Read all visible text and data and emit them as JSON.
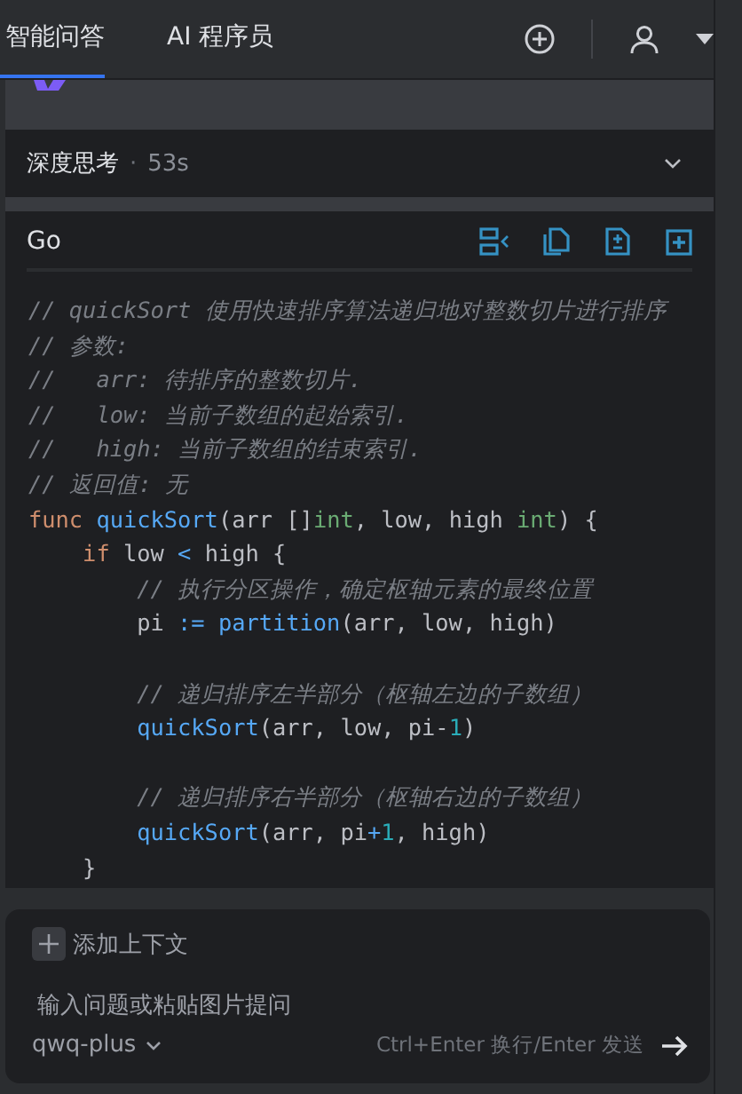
{
  "tabs": [
    {
      "label": "智能问答",
      "selected": true
    },
    {
      "label": "AI 程序员",
      "selected": false
    }
  ],
  "thinking": {
    "label": "深度思考",
    "separator": "·",
    "duration": "53s",
    "expanded": false
  },
  "code_block": {
    "language": "Go",
    "lines": [
      {
        "kind": "code",
        "tokens": [
          {
            "kind": "comment",
            "text": "// quickSort 使用快速排序算法递归地对整数切片进行排序"
          }
        ]
      },
      {
        "kind": "code",
        "tokens": [
          {
            "kind": "comment",
            "text": "// 参数:"
          }
        ]
      },
      {
        "kind": "code",
        "tokens": [
          {
            "kind": "comment",
            "text": "//   arr: 待排序的整数切片."
          }
        ]
      },
      {
        "kind": "code",
        "tokens": [
          {
            "kind": "comment",
            "text": "//   low: 当前子数组的起始索引."
          }
        ]
      },
      {
        "kind": "code",
        "tokens": [
          {
            "kind": "comment",
            "text": "//   high: 当前子数组的结束索引."
          }
        ]
      },
      {
        "kind": "code",
        "tokens": [
          {
            "kind": "comment",
            "text": "// 返回值: 无"
          }
        ]
      },
      {
        "kind": "code",
        "tokens": [
          {
            "kind": "keyword",
            "text": "func "
          },
          {
            "kind": "function",
            "text": "quickSort"
          },
          {
            "kind": "plain",
            "text": "(arr []"
          },
          {
            "kind": "type",
            "text": "int"
          },
          {
            "kind": "plain",
            "text": ", low, high "
          },
          {
            "kind": "type",
            "text": "int"
          },
          {
            "kind": "plain",
            "text": ") {"
          }
        ]
      },
      {
        "kind": "code",
        "tokens": [
          {
            "kind": "keyword",
            "text": "    if "
          },
          {
            "kind": "plain",
            "text": "low "
          },
          {
            "kind": "operator",
            "text": "<"
          },
          {
            "kind": "plain",
            "text": " high {"
          }
        ]
      },
      {
        "kind": "code",
        "tokens": [
          {
            "kind": "comment",
            "text": "        // 执行分区操作，确定枢轴元素的最终位置"
          }
        ]
      },
      {
        "kind": "code",
        "tokens": [
          {
            "kind": "plain",
            "text": "        pi "
          },
          {
            "kind": "operator",
            "text": ":="
          },
          {
            "kind": "function",
            "text": " partition"
          },
          {
            "kind": "plain",
            "text": "(arr, low, high)"
          }
        ]
      },
      {
        "kind": "blank"
      },
      {
        "kind": "code",
        "tokens": [
          {
            "kind": "comment",
            "text": "        // 递归排序左半部分（枢轴左边的子数组）"
          }
        ]
      },
      {
        "kind": "code",
        "tokens": [
          {
            "kind": "function",
            "text": "        quickSort"
          },
          {
            "kind": "plain",
            "text": "(arr, low, pi-"
          },
          {
            "kind": "number",
            "text": "1"
          },
          {
            "kind": "plain",
            "text": ")"
          }
        ]
      },
      {
        "kind": "blank"
      },
      {
        "kind": "code",
        "tokens": [
          {
            "kind": "comment",
            "text": "        // 递归排序右半部分（枢轴右边的子数组）"
          }
        ]
      },
      {
        "kind": "code",
        "tokens": [
          {
            "kind": "function",
            "text": "        quickSort"
          },
          {
            "kind": "plain",
            "text": "(arr, pi"
          },
          {
            "kind": "operator",
            "text": "+"
          },
          {
            "kind": "number",
            "text": "1"
          },
          {
            "kind": "plain",
            "text": ", high)"
          }
        ]
      },
      {
        "kind": "code",
        "tokens": [
          {
            "kind": "plain",
            "text": "    }"
          }
        ]
      }
    ]
  },
  "composer": {
    "add_context": "添加上下文",
    "placeholder": "输入问题或粘贴图片提问",
    "model": "qwq-plus",
    "hint": "Ctrl+Enter 换行/Enter 发送"
  }
}
